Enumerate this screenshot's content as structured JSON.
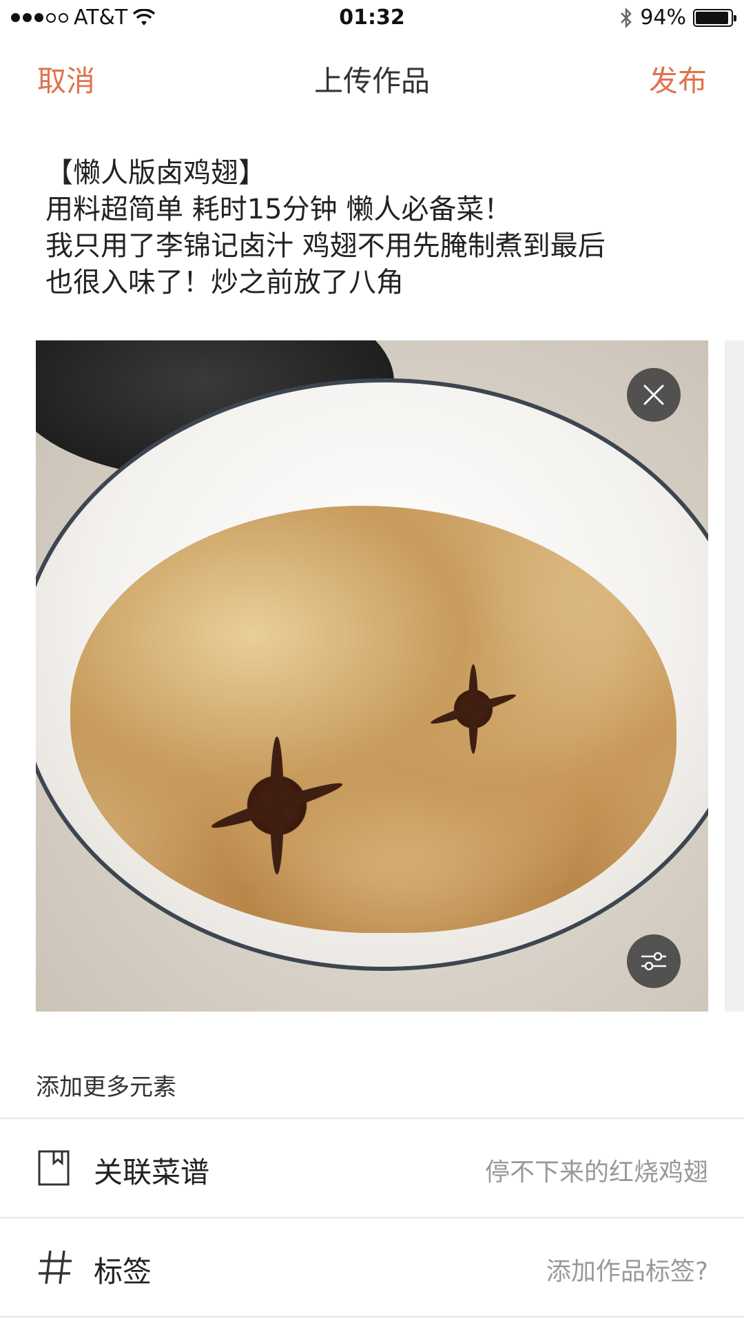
{
  "status_bar": {
    "carrier": "AT&T",
    "time": "01:32",
    "battery": "94%",
    "battery_level": 0.94
  },
  "nav": {
    "cancel": "取消",
    "title": "上传作品",
    "publish": "发布"
  },
  "description": "【懒人版卤鸡翅】\n用料超简单 耗时15分钟 懒人必备菜！\n我只用了李锦记卤汁 鸡翅不用先腌制煮到最后\n也很入味了！炒之前放了八角",
  "section": {
    "more_elements": "添加更多元素"
  },
  "rows": {
    "recipe": {
      "label": "关联菜谱",
      "value": "停不下来的红烧鸡翅"
    },
    "tags": {
      "label": "标签",
      "value": "添加作品标签?"
    }
  },
  "colors": {
    "accent": "#e0734d",
    "hint": "#999999"
  }
}
